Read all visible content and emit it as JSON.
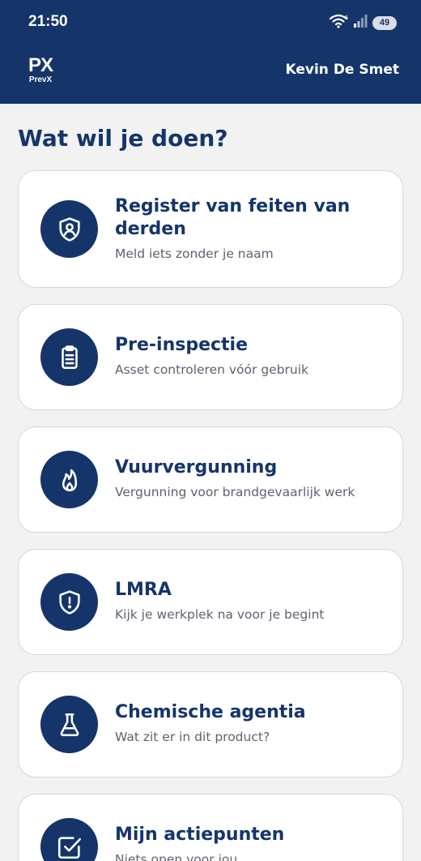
{
  "status_bar": {
    "time": "21:50",
    "network_label": "5",
    "battery": "49"
  },
  "app": {
    "logo_mark": "PX",
    "logo_text": "PrevX",
    "user_name": "Kevin De Smet"
  },
  "page": {
    "title": "Wat wil je doen?"
  },
  "actions": [
    {
      "title": "Register van feiten van derden",
      "subtitle": "Meld iets zonder je naam",
      "icon": "shield-user-icon"
    },
    {
      "title": "Pre-inspectie",
      "subtitle": "Asset controleren vóór gebruik",
      "icon": "clipboard-icon"
    },
    {
      "title": "Vuurvergunning",
      "subtitle": "Vergunning voor brandgevaarlijk werk",
      "icon": "flame-icon"
    },
    {
      "title": "LMRA",
      "subtitle": "Kijk je werkplek na voor je begint",
      "icon": "shield-alert-icon"
    },
    {
      "title": "Chemische agentia",
      "subtitle": "Wat zit er in dit product?",
      "icon": "flask-icon"
    },
    {
      "title": "Mijn actiepunten",
      "subtitle": "Niets open voor jou",
      "icon": "checkbox-icon"
    }
  ],
  "colors": {
    "primary": "#15356a",
    "background": "#f2f2f3",
    "card": "#ffffff",
    "subtitle": "#5c6370"
  }
}
